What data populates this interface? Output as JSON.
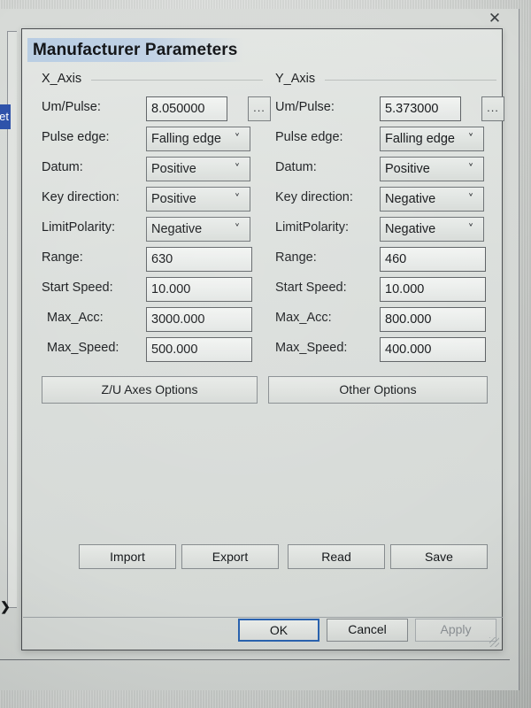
{
  "window": {
    "close_icon": "close-icon",
    "sidebar_tab_label": "et",
    "expander_icon": "chevron-right-icon"
  },
  "dialog": {
    "title": "Manufacturer Parameters",
    "accent_color": "#2a63b0",
    "title_highlight_color": "#b8cde3"
  },
  "axes": [
    {
      "group": "X_Axis",
      "fields": [
        {
          "label": "Um/Pulse:",
          "type": "text",
          "value": "8.050000",
          "has_ellipsis": true,
          "ellipsis_label": "..."
        },
        {
          "label": "Pulse edge:",
          "type": "combo",
          "value": "Falling edge"
        },
        {
          "label": "Datum:",
          "type": "combo",
          "value": "Positive"
        },
        {
          "label": "Key direction:",
          "type": "combo",
          "value": "Positive"
        },
        {
          "label": "LimitPolarity:",
          "type": "combo",
          "value": "Negative"
        },
        {
          "label": "Range:",
          "type": "text",
          "value": "630"
        },
        {
          "label": "Start Speed:",
          "type": "text",
          "value": "10.000"
        },
        {
          "label": "Max_Acc:",
          "type": "text",
          "value": "3000.000"
        },
        {
          "label": "Max_Speed:",
          "type": "text",
          "value": "500.000"
        }
      ]
    },
    {
      "group": "Y_Axis",
      "fields": [
        {
          "label": "Um/Pulse:",
          "type": "text",
          "value": "5.373000",
          "has_ellipsis": true,
          "ellipsis_label": "..."
        },
        {
          "label": "Pulse edge:",
          "type": "combo",
          "value": "Falling edge"
        },
        {
          "label": "Datum:",
          "type": "combo",
          "value": "Positive"
        },
        {
          "label": "Key direction:",
          "type": "combo",
          "value": "Negative"
        },
        {
          "label": "LimitPolarity:",
          "type": "combo",
          "value": "Negative"
        },
        {
          "label": "Range:",
          "type": "text",
          "value": "460"
        },
        {
          "label": "Start Speed:",
          "type": "text",
          "value": "10.000"
        },
        {
          "label": "Max_Acc:",
          "type": "text",
          "value": "800.000"
        },
        {
          "label": "Max_Speed:",
          "type": "text",
          "value": "400.000"
        }
      ]
    }
  ],
  "option_buttons": [
    {
      "label": "Z/U Axes Options"
    },
    {
      "label": "Other Options"
    }
  ],
  "action_buttons": [
    {
      "label": "Import"
    },
    {
      "label": "Export"
    },
    {
      "label": "Read"
    },
    {
      "label": "Save"
    }
  ],
  "dialog_buttons": [
    {
      "label": "OK",
      "state": "default"
    },
    {
      "label": "Cancel",
      "state": "normal"
    },
    {
      "label": "Apply",
      "state": "disabled"
    }
  ]
}
